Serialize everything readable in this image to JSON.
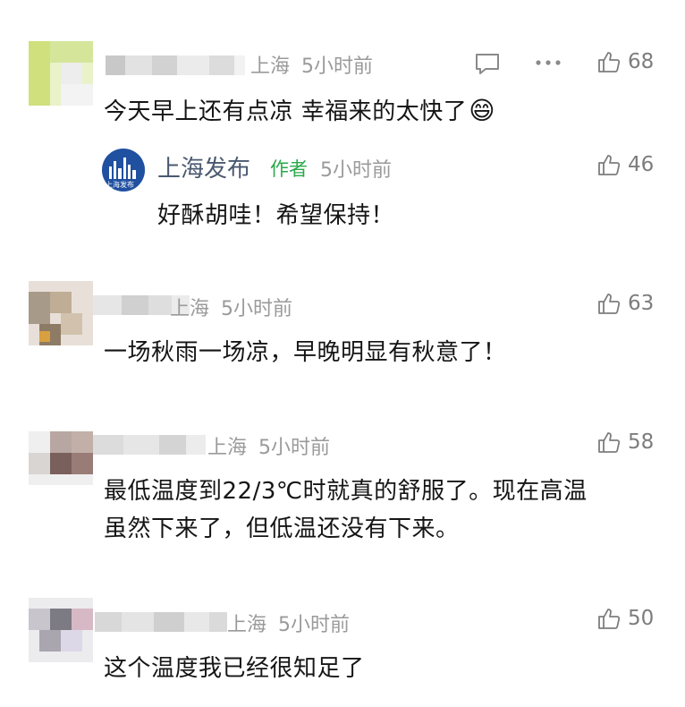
{
  "comments": [
    {
      "location": "上海",
      "time": "5小时前",
      "likes": "68",
      "text": "今天早上还有点凉 幸福来的太快了",
      "emoji": "😄",
      "reply": {
        "name": "上海发布",
        "author_tag": "作者",
        "time": "5小时前",
        "likes": "46",
        "text": "好酥胡哇！希望保持！",
        "avatar_text": "上海发布"
      }
    },
    {
      "location": "上海",
      "time": "5小时前",
      "likes": "63",
      "text": "一场秋雨一场凉，早晚明显有秋意了！"
    },
    {
      "location": "上海",
      "time": "5小时前",
      "likes": "58",
      "text_line1": "最低温度到22/3℃时就真的舒服了。现在高温",
      "text_line2": "虽然下来了，但低温还没有下来。"
    },
    {
      "location": "上海",
      "time": "5小时前",
      "likes": "50",
      "text": "这个温度我已经很知足了"
    }
  ],
  "icons": {
    "comment": "comment-icon",
    "more": "more-icon",
    "like": "thumbs-up-icon"
  },
  "colors": {
    "meta": "#9a9a9a",
    "author_tag": "#2aa84a",
    "reply_name": "#4a5870"
  }
}
